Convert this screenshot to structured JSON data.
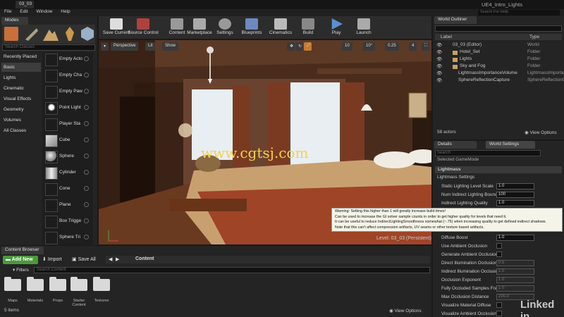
{
  "window": {
    "tab": "03_03",
    "title": "UE4_Intro_Lights",
    "search_help": "Search For Help"
  },
  "menu": [
    "File",
    "Edit",
    "Window",
    "Help"
  ],
  "modes": {
    "tab": "Modes",
    "search_placeholder": "Search Classes",
    "categories": [
      "Recently Placed",
      "Basic",
      "Lights",
      "Cinematic",
      "Visual Effects",
      "Geometry",
      "Volumes",
      "All Classes"
    ],
    "classes": [
      "Empty Acto",
      "Empty Cha",
      "Empty Paw",
      "Point Light",
      "Player Sta",
      "Cube",
      "Sphere",
      "Cylinder",
      "Cone",
      "Plane",
      "Box Trigge",
      "Sphere Tri"
    ]
  },
  "toolbar": [
    "Save Current",
    "Source Control",
    "Content",
    "Marketplace",
    "Settings",
    "Blueprints",
    "Cinematics",
    "Build",
    "Play",
    "Launch"
  ],
  "viewport": {
    "perspective": "Perspective",
    "lit": "Lit",
    "show": "Show",
    "grid": "10",
    "rot": "10°",
    "scale": "0.25",
    "cam": "4",
    "level_label": "Level:",
    "level": "03_03 (Persistent)",
    "watermark": "www.cgtsj.com"
  },
  "outliner": {
    "tab": "World Outliner",
    "col_label": "Label",
    "col_type": "Type",
    "rows": [
      {
        "label": "03_03 (Editor)",
        "type": "World"
      },
      {
        "label": "Hotel_Set",
        "type": "Folder"
      },
      {
        "label": "Lights",
        "type": "Folder"
      },
      {
        "label": "Sky and Fog",
        "type": "Folder"
      },
      {
        "label": "LightmassImportanceVolume",
        "type": "LightmassImporta"
      },
      {
        "label": "SphereReflectionCapture",
        "type": "SphereReflectionC"
      }
    ],
    "count": "58 actors",
    "view_options": "View Options"
  },
  "details": {
    "tab1": "Details",
    "tab2": "World Settings",
    "search_placeholder": "Search",
    "selected": "Selected GameMode",
    "section": "Lightmass",
    "subsection": "Lightmass Settings",
    "props": [
      {
        "label": "Static Lighting Level Scale",
        "value": "1.0"
      },
      {
        "label": "Num Indirect Lighting Bounce",
        "value": "100"
      },
      {
        "label": "Indirect Lighting Quality",
        "value": "1.0"
      }
    ],
    "props2": [
      {
        "label": "Diffuse Boost",
        "value": "1.0",
        "kind": "num"
      },
      {
        "label": "Use Ambient Occlusion",
        "value": "",
        "kind": "check"
      },
      {
        "label": "Generate Ambient Occlusion",
        "value": "",
        "kind": "check"
      },
      {
        "label": "Direct Illumination Occlusion",
        "value": "0.5",
        "kind": "dim"
      },
      {
        "label": "Indirect Illumination Occlusio",
        "value": "1.0",
        "kind": "dim"
      },
      {
        "label": "Occlusion Exponent",
        "value": "1.0",
        "kind": "dim"
      },
      {
        "label": "Fully Occluded Samples Frac",
        "value": "1.0",
        "kind": "dim"
      },
      {
        "label": "Max Occlusion Distance",
        "value": "200.0",
        "kind": "dim"
      },
      {
        "label": "Visualize Material Diffuse",
        "value": "",
        "kind": "check"
      },
      {
        "label": "Visualize Ambient Occlusion",
        "value": "",
        "kind": "check"
      }
    ]
  },
  "tooltip": [
    "Warning: Setting this higher than 1 will greatly increase build times!",
    "Can be used to increase the GI solver sample counts in order to get higher quality for levels that need it.",
    "It can be useful to reduce IndirectLightingSmoothness somewhat (~.75) when increasing quality to get defined indirect shadows.",
    "Note that this can't affect compression artifacts, UV seams or other texture based artifacts."
  ],
  "content": {
    "tab": "Content Browser",
    "add_new": "Add New",
    "import": "Import",
    "save_all": "Save All",
    "path": "Content",
    "filters": "Filters",
    "search_placeholder": "Search Content",
    "folders": [
      "Maps",
      "Materials",
      "Props",
      "Starter Content",
      "Textures"
    ],
    "count": "5 items",
    "view_options": "View Options"
  },
  "logo": "Linked in"
}
